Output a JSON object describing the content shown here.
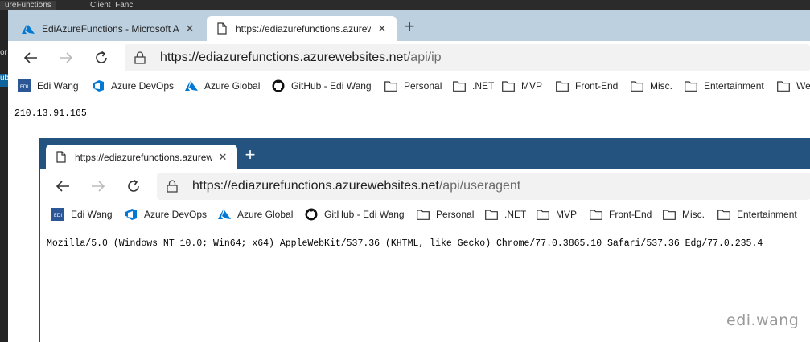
{
  "background": {
    "top_tab_1": "ureFunctions",
    "top_tab_2": "Client  Fanci",
    "side_fragments": [
      "or",
      "ub"
    ]
  },
  "window1": {
    "tabs": [
      {
        "title": "EdiAzureFunctions - Microsoft Az",
        "icon": "azure-icon",
        "active": false
      },
      {
        "title": "https://ediazurefunctions.azurew",
        "icon": "page-icon",
        "active": true
      }
    ],
    "address": {
      "host": "https://ediazurefunctions.azurewebsites.net",
      "path": "/api/ip"
    },
    "favorites": [
      {
        "label": "Edi Wang",
        "icon": "edi-icon"
      },
      {
        "label": "Azure DevOps",
        "icon": "azure-devops-icon"
      },
      {
        "label": "Azure Global",
        "icon": "azure-icon"
      },
      {
        "label": "GitHub - Edi Wang",
        "icon": "github-icon"
      },
      {
        "label": "Personal",
        "icon": "folder-icon"
      },
      {
        "label": ".NET",
        "icon": "folder-icon"
      },
      {
        "label": "MVP",
        "icon": "folder-icon"
      },
      {
        "label": "Front-End",
        "icon": "folder-icon"
      },
      {
        "label": "Misc.",
        "icon": "folder-icon"
      },
      {
        "label": "Entertainment",
        "icon": "folder-icon"
      },
      {
        "label": "We",
        "icon": "folder-icon"
      }
    ],
    "body_text": "210.13.91.165"
  },
  "window2": {
    "tabs": [
      {
        "title": "https://ediazurefunctions.azurew",
        "icon": "page-icon",
        "active": true
      }
    ],
    "address": {
      "host": "https://ediazurefunctions.azurewebsites.net",
      "path": "/api/useragent"
    },
    "favorites": [
      {
        "label": "Edi Wang",
        "icon": "edi-icon"
      },
      {
        "label": "Azure DevOps",
        "icon": "azure-devops-icon"
      },
      {
        "label": "Azure Global",
        "icon": "azure-icon"
      },
      {
        "label": "GitHub - Edi Wang",
        "icon": "github-icon"
      },
      {
        "label": "Personal",
        "icon": "folder-icon"
      },
      {
        "label": ".NET",
        "icon": "folder-icon"
      },
      {
        "label": "MVP",
        "icon": "folder-icon"
      },
      {
        "label": "Front-End",
        "icon": "folder-icon"
      },
      {
        "label": "Misc.",
        "icon": "folder-icon"
      },
      {
        "label": "Entertainment",
        "icon": "folder-icon"
      }
    ],
    "body_text": "Mozilla/5.0 (Windows NT 10.0; Win64; x64) AppleWebKit/537.36 (KHTML, like Gecko) Chrome/77.0.3865.10 Safari/537.36 Edg/77.0.235.4"
  },
  "watermark": "edi.wang",
  "colors": {
    "tabstrip_inactive": "#bcd0e0",
    "tabstrip_active_window": "#245380",
    "address_bg": "#f2f2f2",
    "azure_blue": "#0078d4"
  }
}
